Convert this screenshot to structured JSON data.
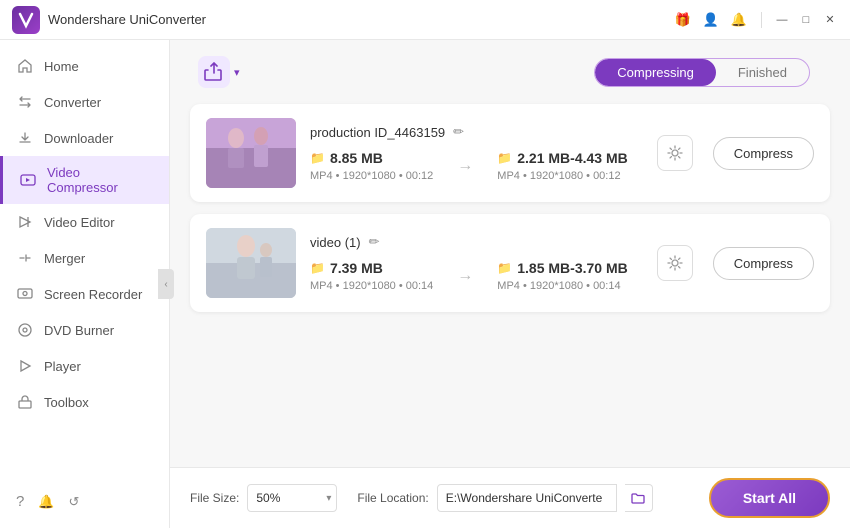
{
  "app": {
    "title": "Wondershare UniConverter",
    "logo_letter": "W"
  },
  "titlebar": {
    "icons": [
      "gift-icon",
      "user-icon",
      "bell-icon"
    ],
    "controls": [
      "minimize-icon",
      "maximize-icon",
      "close-icon"
    ]
  },
  "sidebar": {
    "items": [
      {
        "id": "home",
        "label": "Home",
        "icon": "🏠"
      },
      {
        "id": "converter",
        "label": "Converter",
        "icon": "🔄"
      },
      {
        "id": "downloader",
        "label": "Downloader",
        "icon": "⬇"
      },
      {
        "id": "video-compressor",
        "label": "Video Compressor",
        "icon": "🎬",
        "active": true
      },
      {
        "id": "video-editor",
        "label": "Video Editor",
        "icon": "✂"
      },
      {
        "id": "merger",
        "label": "Merger",
        "icon": "🔗"
      },
      {
        "id": "screen-recorder",
        "label": "Screen Recorder",
        "icon": "📹"
      },
      {
        "id": "dvd-burner",
        "label": "DVD Burner",
        "icon": "💿"
      },
      {
        "id": "player",
        "label": "Player",
        "icon": "▶"
      },
      {
        "id": "toolbox",
        "label": "Toolbox",
        "icon": "🧰"
      }
    ],
    "footer_icons": [
      "help-icon",
      "bell-footer-icon",
      "refresh-icon"
    ]
  },
  "tabs": {
    "compressing": "Compressing",
    "finished": "Finished",
    "active": "compressing"
  },
  "add_button": {
    "icon": "+",
    "dropdown_arrow": "▾"
  },
  "files": [
    {
      "id": "file1",
      "name": "production ID_4463159",
      "source_size": "8.85 MB",
      "source_meta": "MP4  •  1920*1080  •  00:12",
      "target_size": "2.21 MB-4.43 MB",
      "target_meta": "MP4  •  1920*1080  •  00:12",
      "compress_label": "Compress",
      "thumb_class": "thumb-1"
    },
    {
      "id": "file2",
      "name": "video (1)",
      "source_size": "7.39 MB",
      "source_meta": "MP4  •  1920*1080  •  00:14",
      "target_size": "1.85 MB-3.70 MB",
      "target_meta": "MP4  •  1920*1080  •  00:14",
      "compress_label": "Compress",
      "thumb_class": "thumb-2"
    }
  ],
  "bottom_bar": {
    "file_size_label": "File Size:",
    "file_size_value": "50%",
    "file_location_label": "File Location:",
    "file_location_value": "E:\\Wondershare UniConverte",
    "start_all_label": "Start All"
  },
  "collapse_btn": "‹"
}
